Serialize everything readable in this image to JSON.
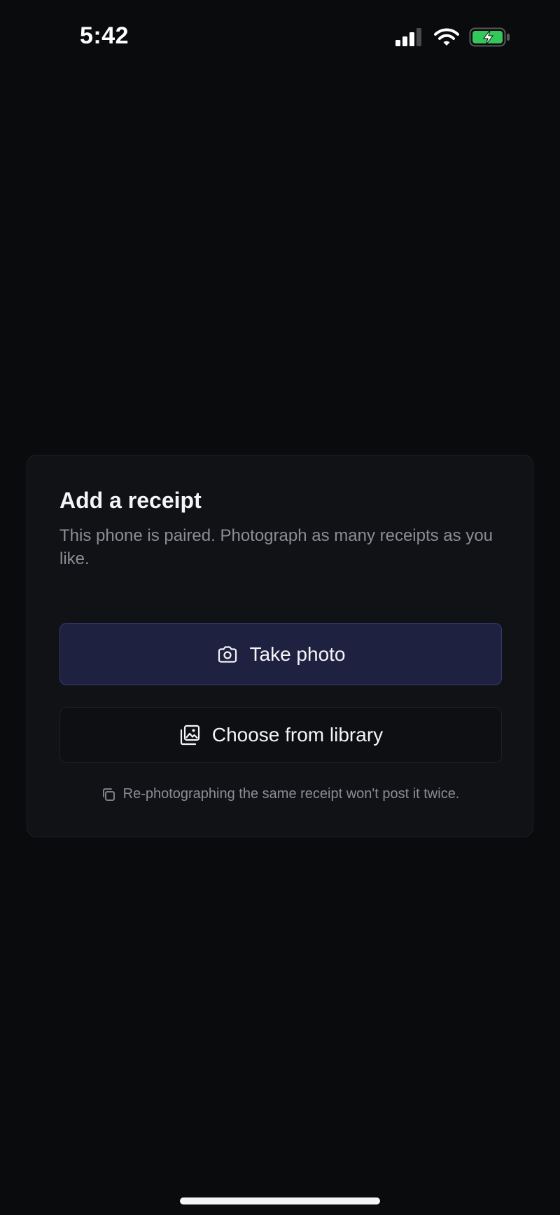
{
  "status_bar": {
    "time": "5:42",
    "icons": [
      "signal-icon",
      "wifi-icon",
      "battery-charging-icon"
    ],
    "battery_color": "#34c759"
  },
  "card": {
    "title": "Add a receipt",
    "subtitle": "This phone is paired. Photograph as many receipts as you like.",
    "primary_button": {
      "label": "Take photo",
      "icon": "camera-icon"
    },
    "secondary_button": {
      "label": "Choose from library",
      "icon": "photo-library-icon"
    },
    "note": {
      "text": "Re-photographing the same receipt won't post it twice.",
      "icon": "copy-icon"
    }
  },
  "colors": {
    "background": "#0a0b0d",
    "card": "#111215",
    "primary_button_bg": "#1f2140",
    "primary_button_border": "#363a72",
    "muted_text": "#8a8d94"
  }
}
